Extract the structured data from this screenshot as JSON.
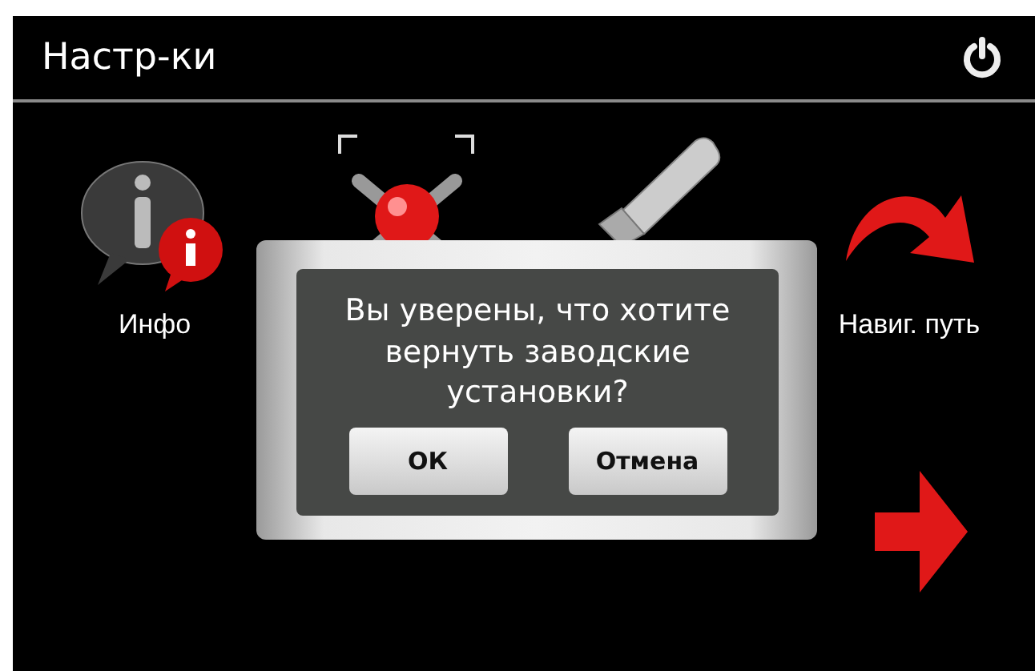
{
  "header": {
    "title": "Настр-ки"
  },
  "items": [
    {
      "kind": "info",
      "label": "Инфо",
      "selected": false
    },
    {
      "kind": "tools",
      "selected": true
    },
    {
      "kind": "usb",
      "selected": false
    },
    {
      "kind": "route",
      "label": "Навиг. путь",
      "selected": false
    }
  ],
  "dialog": {
    "message": "Вы уверены, что хотите вернуть заводские установки?",
    "buttons": [
      "ОК",
      "Отмена"
    ]
  }
}
